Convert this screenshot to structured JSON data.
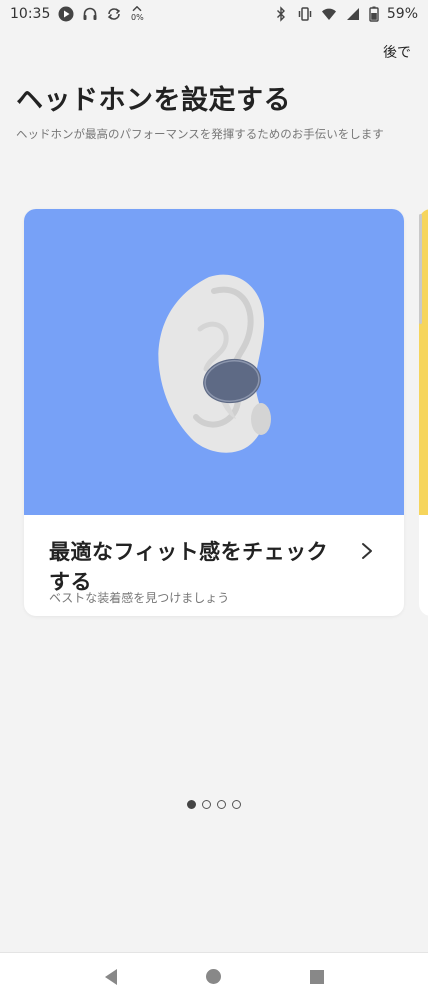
{
  "status_bar": {
    "time": "10:35",
    "data_rate": "0%",
    "battery": "59%",
    "icons": [
      "play-icon",
      "headphones-icon",
      "sync-icon",
      "data-saver-icon",
      "bluetooth-icon",
      "vibrate-icon",
      "wifi-icon",
      "signal-icon",
      "battery-icon"
    ]
  },
  "header": {
    "later_label": "後で",
    "title": "ヘッドホンを設定する",
    "subtitle": "ヘッドホンが最高のパフォーマンスを発揮するためのお手伝いをします"
  },
  "cards": [
    {
      "title": "最適なフィット感をチェックする",
      "description": "ベストな装着感を見つけましょう",
      "image_color": "#77a1f7",
      "icon": "ear-with-earbud-illustration"
    }
  ],
  "next_card": {
    "image_color": "#f6d55c"
  },
  "pager": {
    "total": 4,
    "active": 0
  },
  "nav_bar": {
    "buttons": [
      "back-icon",
      "home-icon",
      "recents-icon"
    ]
  }
}
